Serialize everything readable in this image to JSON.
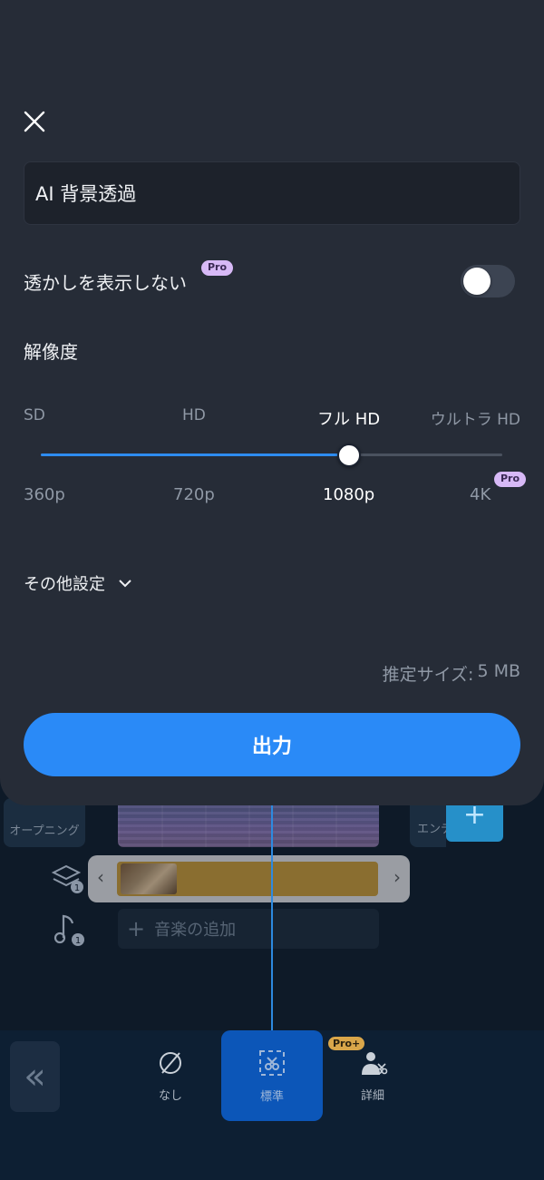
{
  "export_sheet": {
    "project_name": "AI 背景透過",
    "watermark": {
      "label": "透かしを表示しない",
      "badge": "Pro",
      "enabled": false
    },
    "resolution": {
      "title": "解像度",
      "levels": [
        {
          "quality": "SD",
          "pixels": "360p"
        },
        {
          "quality": "HD",
          "pixels": "720p"
        },
        {
          "quality": "フル HD",
          "pixels": "1080p"
        },
        {
          "quality": "ウルトラ HD",
          "pixels": "4K",
          "badge": "Pro"
        }
      ],
      "selected_index": 2
    },
    "more_settings_label": "その他設定",
    "estimated_size": {
      "label": "推定サイズ:",
      "value": "5 MB"
    },
    "export_label": "出力"
  },
  "editor": {
    "opening_label": "オープニング",
    "ending_label": "エンディ",
    "overlay_count": "1",
    "music_count": "1",
    "add_music_label": "音楽の追加",
    "toolbar": {
      "none_label": "なし",
      "standard_label": "標準",
      "detail_label": "詳細",
      "detail_badge": "Pro+"
    }
  },
  "colors": {
    "accent": "#2a8af7",
    "sheet_bg": "#262c37",
    "pro_badge": "#d7b9f6",
    "pro_plus_badge": "#d9a64a"
  }
}
